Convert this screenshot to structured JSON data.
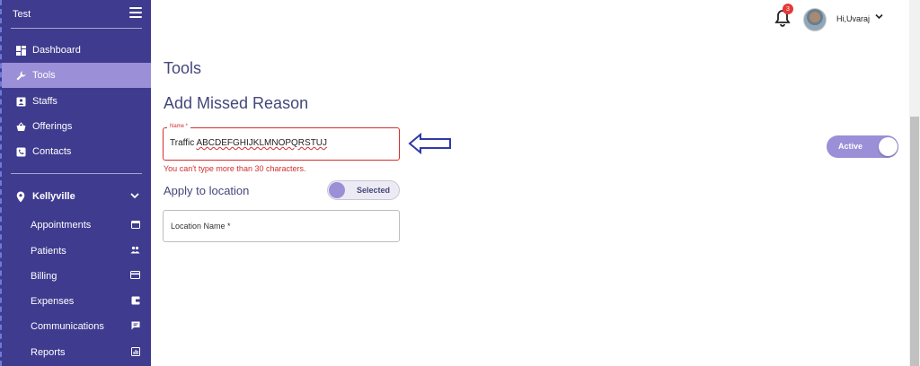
{
  "sidebar": {
    "brand": "Test",
    "menu": [
      {
        "label": "Dashboard",
        "icon": "dashboard-icon"
      },
      {
        "label": "Tools",
        "icon": "wrench-icon",
        "active": true
      },
      {
        "label": "Staffs",
        "icon": "badge-icon"
      },
      {
        "label": "Offerings",
        "icon": "basket-icon"
      },
      {
        "label": "Contacts",
        "icon": "contact-icon"
      }
    ],
    "location": "Kellyville",
    "sub_items": [
      {
        "label": "Appointments",
        "icon": "calendar-icon"
      },
      {
        "label": "Patients",
        "icon": "people-icon"
      },
      {
        "label": "Billing",
        "icon": "card-icon"
      },
      {
        "label": "Expenses",
        "icon": "wallet-icon"
      },
      {
        "label": "Communications",
        "icon": "chat-icon"
      },
      {
        "label": "Reports",
        "icon": "report-icon"
      }
    ]
  },
  "topbar": {
    "notification_count": "3",
    "greeting": "Hi,Uvaraj"
  },
  "main": {
    "page_title": "Tools",
    "section_title": "Add Missed Reason",
    "name_field": {
      "label": "Name *",
      "value_plain": "Traffic ",
      "value_squiggly": "ABCDEFGHIJKLMNOPQRSTUJ",
      "error": "You can't type more than 30 characters."
    },
    "apply_label": "Apply to location",
    "apply_toggle": "Selected",
    "location_field": {
      "placeholder": "Location Name *"
    },
    "status_toggle": "Active"
  },
  "colors": {
    "sidebar_bg": "#3f3b8f",
    "accent": "#9b8fd8",
    "error": "#d32f2f",
    "heading": "#44477a"
  }
}
